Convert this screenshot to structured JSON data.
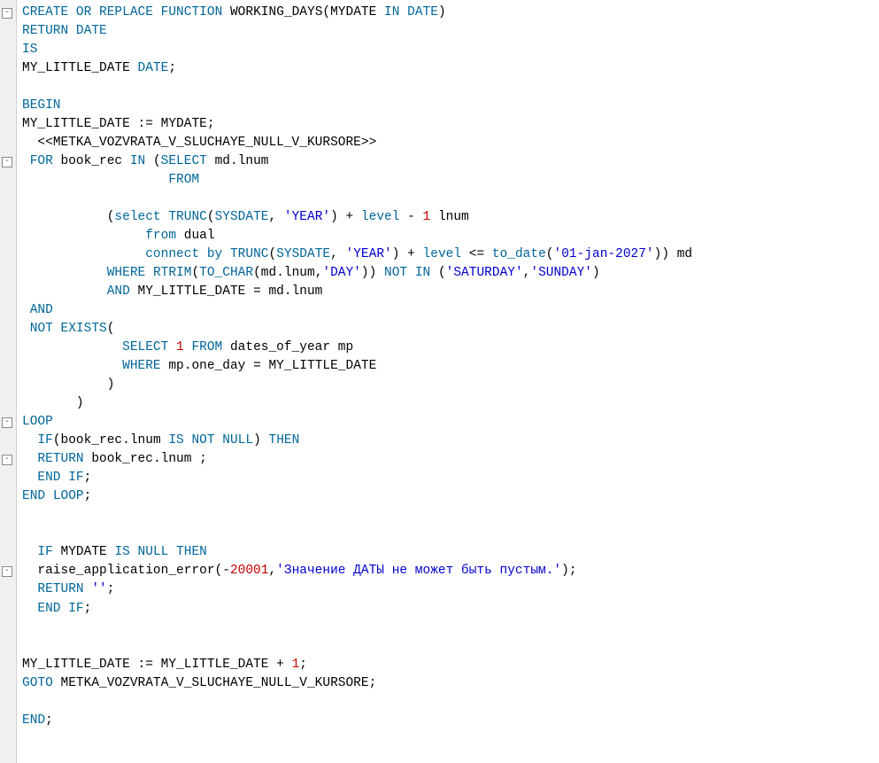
{
  "fold_markers": [
    1,
    9,
    23,
    25,
    31
  ],
  "lines": [
    [
      [
        "kw",
        "CREATE"
      ],
      [
        "op",
        " "
      ],
      [
        "kw",
        "OR"
      ],
      [
        "op",
        " "
      ],
      [
        "kw",
        "REPLACE"
      ],
      [
        "op",
        " "
      ],
      [
        "kw",
        "FUNCTION"
      ],
      [
        "op",
        " "
      ],
      [
        "ident",
        "WORKING_DAYS"
      ],
      [
        "punc",
        "("
      ],
      [
        "ident",
        "MYDATE"
      ],
      [
        "op",
        " "
      ],
      [
        "kw",
        "IN"
      ],
      [
        "op",
        " "
      ],
      [
        "kw",
        "DATE"
      ],
      [
        "punc",
        ")"
      ]
    ],
    [
      [
        "kw",
        "RETURN"
      ],
      [
        "op",
        " "
      ],
      [
        "kw",
        "DATE"
      ]
    ],
    [
      [
        "kw",
        "IS"
      ]
    ],
    [
      [
        "ident",
        "MY_LITTLE_DATE"
      ],
      [
        "op",
        " "
      ],
      [
        "kw",
        "DATE"
      ],
      [
        "punc",
        ";"
      ]
    ],
    [],
    [
      [
        "kw",
        "BEGIN"
      ]
    ],
    [
      [
        "ident",
        "MY_LITTLE_DATE"
      ],
      [
        "op",
        " "
      ],
      [
        "punc",
        ":="
      ],
      [
        "op",
        " "
      ],
      [
        "ident",
        "MYDATE"
      ],
      [
        "punc",
        ";"
      ]
    ],
    [
      [
        "op",
        "  "
      ],
      [
        "punc",
        "<<"
      ],
      [
        "ident",
        "METKA_VOZVRATA_V_SLUCHAYE_NULL_V_KURSORE"
      ],
      [
        "punc",
        ">>"
      ]
    ],
    [
      [
        "op",
        " "
      ],
      [
        "kw",
        "FOR"
      ],
      [
        "op",
        " "
      ],
      [
        "ident",
        "book_rec"
      ],
      [
        "op",
        " "
      ],
      [
        "kw",
        "IN"
      ],
      [
        "op",
        " "
      ],
      [
        "punc",
        "("
      ],
      [
        "kw",
        "SELECT"
      ],
      [
        "op",
        " "
      ],
      [
        "ident",
        "md"
      ],
      [
        "punc",
        "."
      ],
      [
        "ident",
        "lnum"
      ]
    ],
    [
      [
        "op",
        "                   "
      ],
      [
        "kw",
        "FROM"
      ]
    ],
    [],
    [
      [
        "op",
        "           "
      ],
      [
        "punc",
        "("
      ],
      [
        "kw",
        "select"
      ],
      [
        "op",
        " "
      ],
      [
        "kw",
        "TRUNC"
      ],
      [
        "punc",
        "("
      ],
      [
        "kw",
        "SYSDATE"
      ],
      [
        "punc",
        ","
      ],
      [
        "op",
        " "
      ],
      [
        "str",
        "'YEAR'"
      ],
      [
        "punc",
        ")"
      ],
      [
        "op",
        " "
      ],
      [
        "punc",
        "+"
      ],
      [
        "op",
        " "
      ],
      [
        "kw",
        "level"
      ],
      [
        "op",
        " "
      ],
      [
        "punc",
        "-"
      ],
      [
        "op",
        " "
      ],
      [
        "num",
        "1"
      ],
      [
        "op",
        " "
      ],
      [
        "ident",
        "lnum"
      ]
    ],
    [
      [
        "op",
        "                "
      ],
      [
        "kw",
        "from"
      ],
      [
        "op",
        " "
      ],
      [
        "ident",
        "dual"
      ]
    ],
    [
      [
        "op",
        "                "
      ],
      [
        "kw",
        "connect"
      ],
      [
        "op",
        " "
      ],
      [
        "kw",
        "by"
      ],
      [
        "op",
        " "
      ],
      [
        "kw",
        "TRUNC"
      ],
      [
        "punc",
        "("
      ],
      [
        "kw",
        "SYSDATE"
      ],
      [
        "punc",
        ","
      ],
      [
        "op",
        " "
      ],
      [
        "str",
        "'YEAR'"
      ],
      [
        "punc",
        ")"
      ],
      [
        "op",
        " "
      ],
      [
        "punc",
        "+"
      ],
      [
        "op",
        " "
      ],
      [
        "kw",
        "level"
      ],
      [
        "op",
        " "
      ],
      [
        "punc",
        "<="
      ],
      [
        "op",
        " "
      ],
      [
        "kw",
        "to_date"
      ],
      [
        "punc",
        "("
      ],
      [
        "str",
        "'01-jan-2027'"
      ],
      [
        "punc",
        "))"
      ],
      [
        "op",
        " "
      ],
      [
        "ident",
        "md"
      ]
    ],
    [
      [
        "op",
        "           "
      ],
      [
        "kw",
        "WHERE"
      ],
      [
        "op",
        " "
      ],
      [
        "kw",
        "RTRIM"
      ],
      [
        "punc",
        "("
      ],
      [
        "kw",
        "TO_CHAR"
      ],
      [
        "punc",
        "("
      ],
      [
        "ident",
        "md"
      ],
      [
        "punc",
        "."
      ],
      [
        "ident",
        "lnum"
      ],
      [
        "punc",
        ","
      ],
      [
        "str",
        "'DAY'"
      ],
      [
        "punc",
        "))"
      ],
      [
        "op",
        " "
      ],
      [
        "kw",
        "NOT"
      ],
      [
        "op",
        " "
      ],
      [
        "kw",
        "IN"
      ],
      [
        "op",
        " "
      ],
      [
        "punc",
        "("
      ],
      [
        "str",
        "'SATURDAY'"
      ],
      [
        "punc",
        ","
      ],
      [
        "str",
        "'SUNDAY'"
      ],
      [
        "punc",
        ")"
      ]
    ],
    [
      [
        "op",
        "           "
      ],
      [
        "kw",
        "AND"
      ],
      [
        "op",
        " "
      ],
      [
        "ident",
        "MY_LITTLE_DATE"
      ],
      [
        "op",
        " "
      ],
      [
        "punc",
        "="
      ],
      [
        "op",
        " "
      ],
      [
        "ident",
        "md"
      ],
      [
        "punc",
        "."
      ],
      [
        "ident",
        "lnum"
      ]
    ],
    [
      [
        "op",
        " "
      ],
      [
        "kw",
        "AND"
      ]
    ],
    [
      [
        "op",
        " "
      ],
      [
        "kw",
        "NOT"
      ],
      [
        "op",
        " "
      ],
      [
        "kw",
        "EXISTS"
      ],
      [
        "punc",
        "("
      ]
    ],
    [
      [
        "op",
        "             "
      ],
      [
        "kw",
        "SELECT"
      ],
      [
        "op",
        " "
      ],
      [
        "num",
        "1"
      ],
      [
        "op",
        " "
      ],
      [
        "kw",
        "FROM"
      ],
      [
        "op",
        " "
      ],
      [
        "ident",
        "dates_of_year"
      ],
      [
        "op",
        " "
      ],
      [
        "ident",
        "mp"
      ]
    ],
    [
      [
        "op",
        "             "
      ],
      [
        "kw",
        "WHERE"
      ],
      [
        "op",
        " "
      ],
      [
        "ident",
        "mp"
      ],
      [
        "punc",
        "."
      ],
      [
        "ident",
        "one_day"
      ],
      [
        "op",
        " "
      ],
      [
        "punc",
        "="
      ],
      [
        "op",
        " "
      ],
      [
        "ident",
        "MY_LITTLE_DATE"
      ]
    ],
    [
      [
        "op",
        "           "
      ],
      [
        "punc",
        ")"
      ]
    ],
    [
      [
        "op",
        "       "
      ],
      [
        "punc",
        ")"
      ]
    ],
    [
      [
        "kw",
        "LOOP"
      ]
    ],
    [
      [
        "op",
        "  "
      ],
      [
        "kw",
        "IF"
      ],
      [
        "punc",
        "("
      ],
      [
        "ident",
        "book_rec"
      ],
      [
        "punc",
        "."
      ],
      [
        "ident",
        "lnum"
      ],
      [
        "op",
        " "
      ],
      [
        "kw",
        "IS"
      ],
      [
        "op",
        " "
      ],
      [
        "kw",
        "NOT"
      ],
      [
        "op",
        " "
      ],
      [
        "kw",
        "NULL"
      ],
      [
        "punc",
        ")"
      ],
      [
        "op",
        " "
      ],
      [
        "kw",
        "THEN"
      ]
    ],
    [
      [
        "op",
        "  "
      ],
      [
        "kw",
        "RETURN"
      ],
      [
        "op",
        " "
      ],
      [
        "ident",
        "book_rec"
      ],
      [
        "punc",
        "."
      ],
      [
        "ident",
        "lnum"
      ],
      [
        "op",
        " "
      ],
      [
        "punc",
        ";"
      ]
    ],
    [
      [
        "op",
        "  "
      ],
      [
        "kw",
        "END"
      ],
      [
        "op",
        " "
      ],
      [
        "kw",
        "IF"
      ],
      [
        "punc",
        ";"
      ]
    ],
    [
      [
        "kw",
        "END"
      ],
      [
        "op",
        " "
      ],
      [
        "kw",
        "LOOP"
      ],
      [
        "punc",
        ";"
      ]
    ],
    [],
    [],
    [
      [
        "op",
        "  "
      ],
      [
        "kw",
        "IF"
      ],
      [
        "op",
        " "
      ],
      [
        "ident",
        "MYDATE"
      ],
      [
        "op",
        " "
      ],
      [
        "kw",
        "IS"
      ],
      [
        "op",
        " "
      ],
      [
        "kw",
        "NULL"
      ],
      [
        "op",
        " "
      ],
      [
        "kw",
        "THEN"
      ]
    ],
    [
      [
        "op",
        "  "
      ],
      [
        "ident",
        "raise_application_error"
      ],
      [
        "punc",
        "("
      ],
      [
        "punc",
        "-"
      ],
      [
        "num",
        "20001"
      ],
      [
        "punc",
        ","
      ],
      [
        "str",
        "'Значение ДАТЫ не может быть пустым.'"
      ],
      [
        "punc",
        ")"
      ],
      [
        "punc",
        ";"
      ]
    ],
    [
      [
        "op",
        "  "
      ],
      [
        "kw",
        "RETURN"
      ],
      [
        "op",
        " "
      ],
      [
        "str",
        "''"
      ],
      [
        "punc",
        ";"
      ]
    ],
    [
      [
        "op",
        "  "
      ],
      [
        "kw",
        "END"
      ],
      [
        "op",
        " "
      ],
      [
        "kw",
        "IF"
      ],
      [
        "punc",
        ";"
      ]
    ],
    [],
    [],
    [
      [
        "ident",
        "MY_LITTLE_DATE"
      ],
      [
        "op",
        " "
      ],
      [
        "punc",
        ":="
      ],
      [
        "op",
        " "
      ],
      [
        "ident",
        "MY_LITTLE_DATE"
      ],
      [
        "op",
        " "
      ],
      [
        "punc",
        "+"
      ],
      [
        "op",
        " "
      ],
      [
        "num",
        "1"
      ],
      [
        "punc",
        ";"
      ]
    ],
    [
      [
        "kw",
        "GOTO"
      ],
      [
        "op",
        " "
      ],
      [
        "ident",
        "METKA_VOZVRATA_V_SLUCHAYE_NULL_V_KURSORE"
      ],
      [
        "punc",
        ";"
      ]
    ],
    [],
    [
      [
        "kw",
        "END"
      ],
      [
        "punc",
        ";"
      ]
    ]
  ]
}
